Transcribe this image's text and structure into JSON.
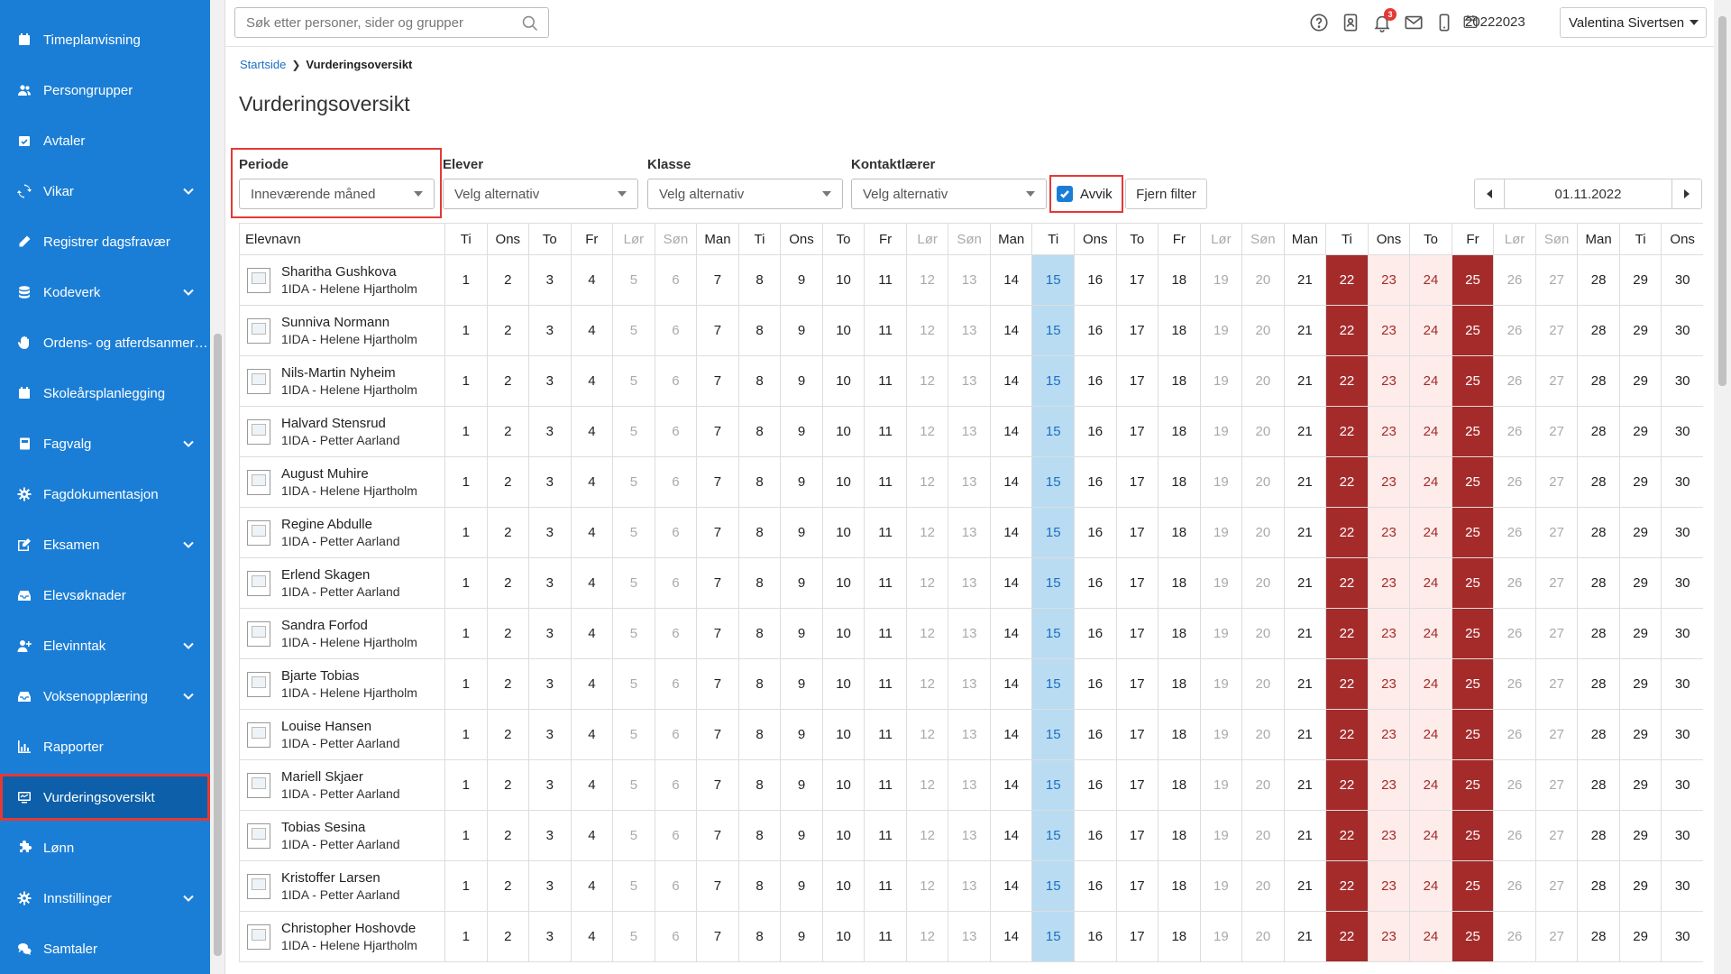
{
  "sidebar": {
    "items": [
      {
        "label": "Timeplanvisning",
        "icon": "calendar-icon",
        "chevron": false
      },
      {
        "label": "Persongrupper",
        "icon": "users-icon",
        "chevron": false
      },
      {
        "label": "Avtaler",
        "icon": "calendar-check-icon",
        "chevron": false
      },
      {
        "label": "Vikar",
        "icon": "refresh-icon",
        "chevron": true
      },
      {
        "label": "Registrer dagsfravær",
        "icon": "pencil-icon",
        "chevron": false
      },
      {
        "label": "Kodeverk",
        "icon": "database-icon",
        "chevron": true
      },
      {
        "label": "Ordens- og atferdsanmerk...",
        "icon": "hand-icon",
        "chevron": false
      },
      {
        "label": "Skoleårsplanlegging",
        "icon": "calendar-icon",
        "chevron": false
      },
      {
        "label": "Fagvalg",
        "icon": "book-icon",
        "chevron": true
      },
      {
        "label": "Fagdokumentasjon",
        "icon": "gear-icon",
        "chevron": false
      },
      {
        "label": "Eksamen",
        "icon": "edit-icon",
        "chevron": true
      },
      {
        "label": "Elevsøknader",
        "icon": "inbox-icon",
        "chevron": false
      },
      {
        "label": "Elevinntak",
        "icon": "user-plus-icon",
        "chevron": true
      },
      {
        "label": "Voksenopplæring",
        "icon": "inbox-icon",
        "chevron": true
      },
      {
        "label": "Rapporter",
        "icon": "chart-icon",
        "chevron": false
      },
      {
        "label": "Vurderingsoversikt",
        "icon": "assessment-icon",
        "chevron": false,
        "active": true
      },
      {
        "label": "Lønn",
        "icon": "puzzle-icon",
        "chevron": false
      },
      {
        "label": "Innstillinger",
        "icon": "gear-icon",
        "chevron": true
      },
      {
        "label": "Samtaler",
        "icon": "chat-icon",
        "chevron": false
      }
    ]
  },
  "topbar": {
    "search_placeholder": "Søk etter personer, sider og grupper",
    "notification_count": "3",
    "school_year": "20222023",
    "user_name": "Valentina Sivertsen"
  },
  "breadcrumb": {
    "home": "Startside",
    "current": "Vurderingsoversikt"
  },
  "page_title": "Vurderingsoversikt",
  "filters": {
    "periode": {
      "label": "Periode",
      "value": "Inneværende måned"
    },
    "elever": {
      "label": "Elever",
      "value": "Velg alternativ"
    },
    "klasse": {
      "label": "Klasse",
      "value": "Velg alternativ"
    },
    "kontaktlaerer": {
      "label": "Kontaktlærer",
      "value": "Velg alternativ"
    },
    "avvik_label": "Avvik",
    "avvik_checked": true,
    "clear_label": "Fjern filter",
    "date": "01.11.2022"
  },
  "table": {
    "name_header": "Elevnavn",
    "days": [
      {
        "dow": "Ti",
        "date": "1",
        "type": "normal"
      },
      {
        "dow": "Ons",
        "date": "2",
        "type": "normal"
      },
      {
        "dow": "To",
        "date": "3",
        "type": "normal"
      },
      {
        "dow": "Fr",
        "date": "4",
        "type": "normal"
      },
      {
        "dow": "Lør",
        "date": "5",
        "type": "weekend"
      },
      {
        "dow": "Søn",
        "date": "6",
        "type": "weekend"
      },
      {
        "dow": "Man",
        "date": "7",
        "type": "normal"
      },
      {
        "dow": "Ti",
        "date": "8",
        "type": "normal"
      },
      {
        "dow": "Ons",
        "date": "9",
        "type": "normal"
      },
      {
        "dow": "To",
        "date": "10",
        "type": "normal"
      },
      {
        "dow": "Fr",
        "date": "11",
        "type": "normal"
      },
      {
        "dow": "Lør",
        "date": "12",
        "type": "weekend"
      },
      {
        "dow": "Søn",
        "date": "13",
        "type": "weekend"
      },
      {
        "dow": "Man",
        "date": "14",
        "type": "normal"
      },
      {
        "dow": "Ti",
        "date": "15",
        "type": "today"
      },
      {
        "dow": "Ons",
        "date": "16",
        "type": "normal"
      },
      {
        "dow": "To",
        "date": "17",
        "type": "normal"
      },
      {
        "dow": "Fr",
        "date": "18",
        "type": "normal"
      },
      {
        "dow": "Lør",
        "date": "19",
        "type": "weekend"
      },
      {
        "dow": "Søn",
        "date": "20",
        "type": "weekend"
      },
      {
        "dow": "Man",
        "date": "21",
        "type": "normal"
      },
      {
        "dow": "Ti",
        "date": "22",
        "type": "dev"
      },
      {
        "dow": "Ons",
        "date": "23",
        "type": "light"
      },
      {
        "dow": "To",
        "date": "24",
        "type": "light"
      },
      {
        "dow": "Fr",
        "date": "25",
        "type": "dev"
      },
      {
        "dow": "Lør",
        "date": "26",
        "type": "weekend"
      },
      {
        "dow": "Søn",
        "date": "27",
        "type": "weekend"
      },
      {
        "dow": "Man",
        "date": "28",
        "type": "normal"
      },
      {
        "dow": "Ti",
        "date": "29",
        "type": "normal"
      },
      {
        "dow": "Ons",
        "date": "30",
        "type": "normal"
      }
    ],
    "students": [
      {
        "name": "Sharitha Gushkova",
        "class": "1IDA  - Helene Hjartholm"
      },
      {
        "name": "Sunniva Normann",
        "class": "1IDA  - Helene Hjartholm"
      },
      {
        "name": "Nils-Martin Nyheim",
        "class": "1IDA  - Helene Hjartholm"
      },
      {
        "name": "Halvard Stensrud",
        "class": "1IDA  - Petter Aarland"
      },
      {
        "name": "August Muhire",
        "class": "1IDA  - Helene Hjartholm"
      },
      {
        "name": "Regine Abdulle",
        "class": "1IDA  - Petter Aarland"
      },
      {
        "name": "Erlend Skagen",
        "class": "1IDA  - Petter Aarland"
      },
      {
        "name": "Sandra Forfod",
        "class": "1IDA  - Helene Hjartholm"
      },
      {
        "name": "Bjarte Tobias",
        "class": "1IDA  - Helene Hjartholm"
      },
      {
        "name": "Louise Hansen",
        "class": "1IDA  - Petter Aarland"
      },
      {
        "name": "Mariell Skjaer",
        "class": "1IDA  - Petter Aarland"
      },
      {
        "name": "Tobias Sesina",
        "class": "1IDA  - Petter Aarland"
      },
      {
        "name": "Kristoffer Larsen",
        "class": "1IDA  - Petter Aarland"
      },
      {
        "name": "Christopher Hoshovde",
        "class": "1IDA  - Helene Hjartholm"
      }
    ]
  },
  "colors": {
    "sidebar": "#1b7ed6",
    "deviation": "#a52a2a",
    "deviation_light": "#fdecea",
    "today": "#b9dcf2",
    "highlight": "#e53935"
  }
}
